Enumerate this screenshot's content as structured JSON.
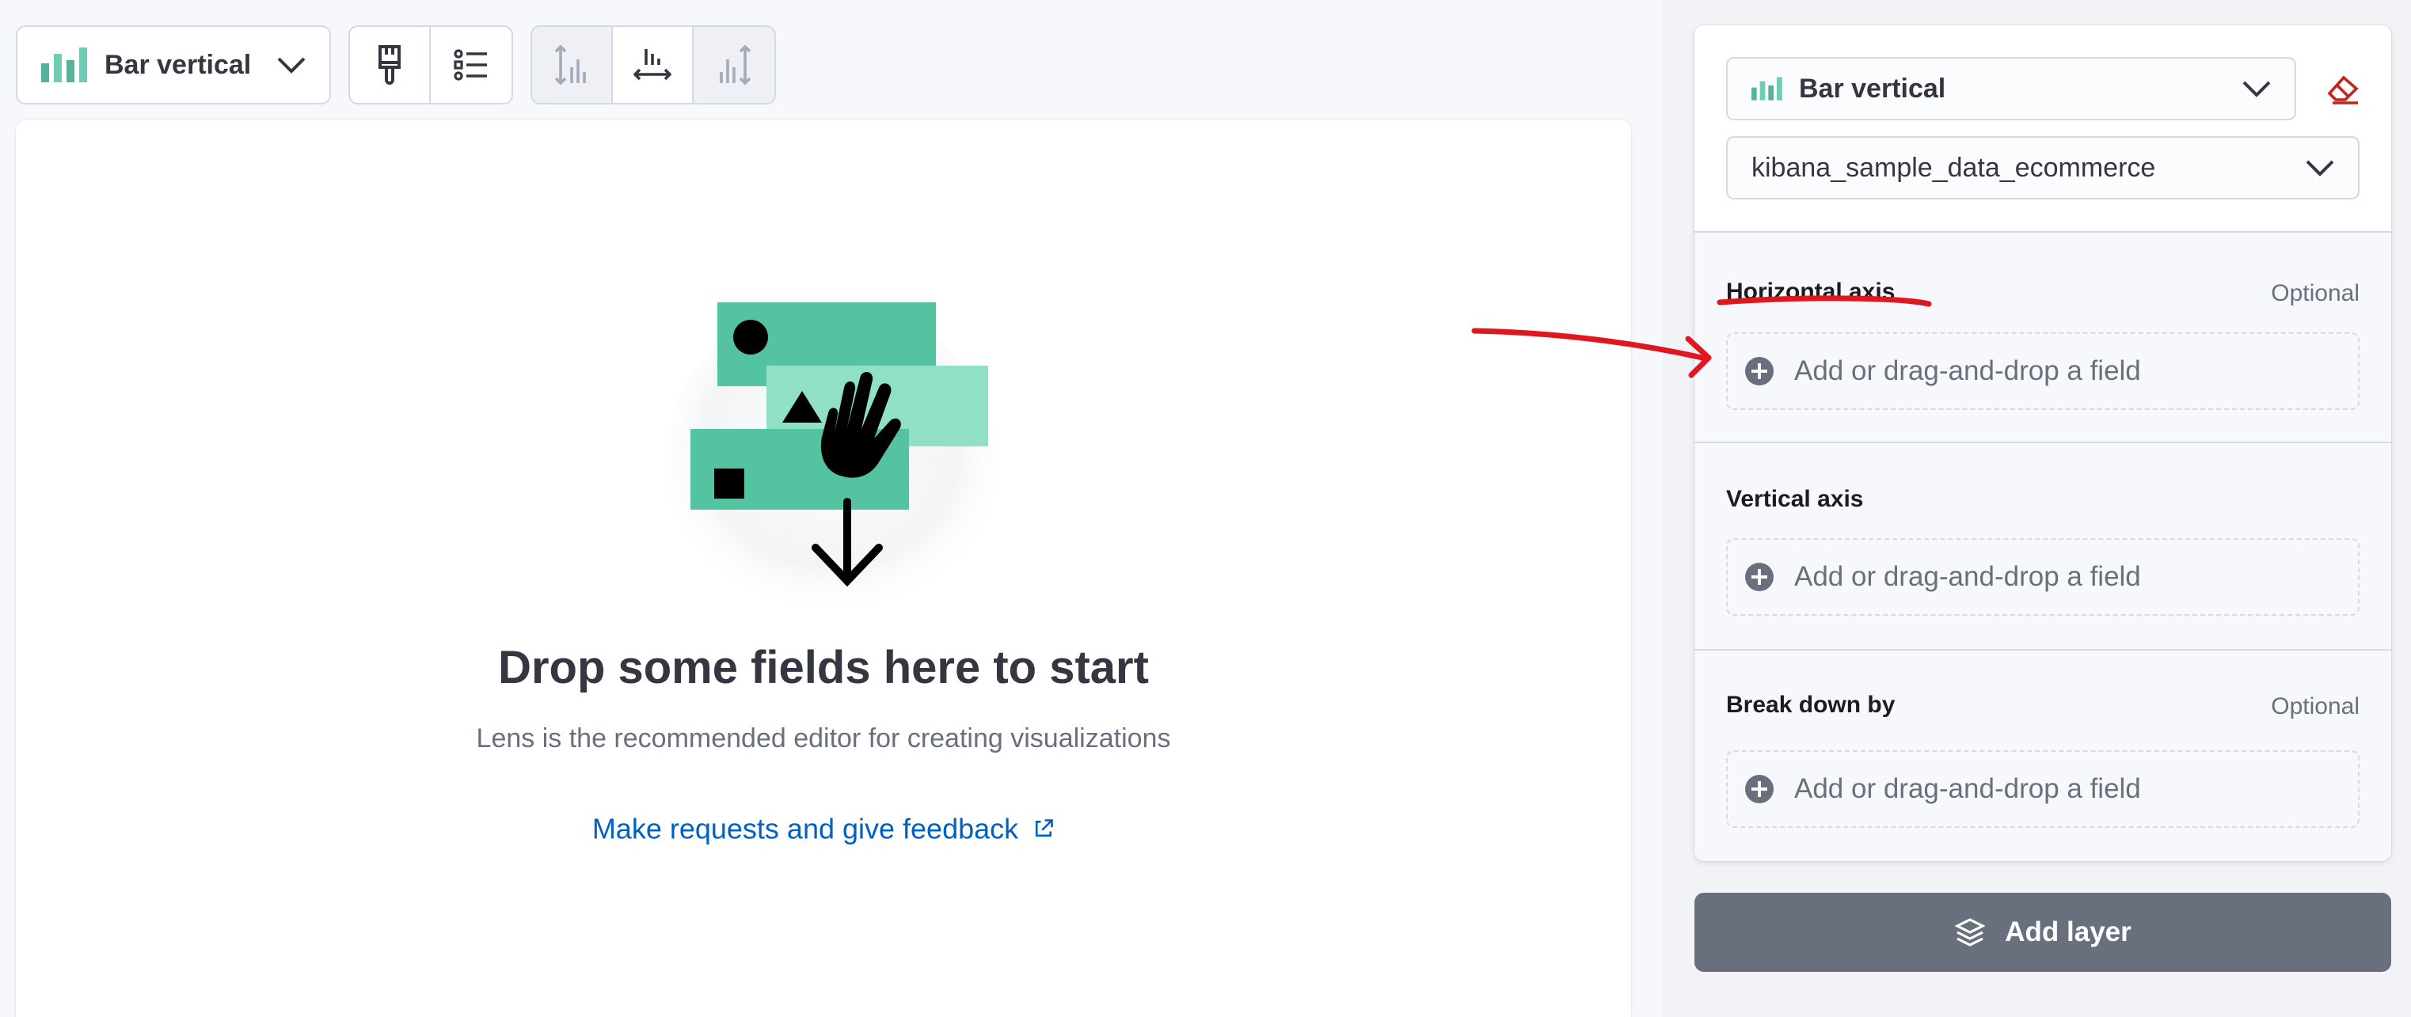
{
  "toolbar": {
    "chart_type_label": "Bar vertical",
    "icons": [
      "bar-chart-icon",
      "chevron-down-icon",
      "paintbrush-icon",
      "legend-list-icon",
      "left-axis-icon",
      "bottom-axis-icon",
      "right-axis-icon"
    ]
  },
  "workspace": {
    "title": "Drop some fields here to start",
    "subtitle": "Lens is the recommended editor for creating visualizations",
    "feedback_link": "Make requests and give feedback"
  },
  "panel": {
    "chart_type": "Bar vertical",
    "index_pattern": "kibana_sample_data_ecommerce",
    "sections": {
      "horizontal": {
        "title": "Horizontal axis",
        "optional": "Optional",
        "placeholder": "Add or drag-and-drop a field"
      },
      "vertical": {
        "title": "Vertical axis",
        "placeholder": "Add or drag-and-drop a field"
      },
      "breakdown": {
        "title": "Break down by",
        "optional": "Optional",
        "placeholder": "Add or drag-and-drop a field"
      }
    },
    "add_layer": "Add layer"
  },
  "colors": {
    "accent_green": "#54b399",
    "link_blue": "#0061c2",
    "annotation_red": "#e0171f",
    "danger_red": "#bd271e",
    "button_gray": "#69707d"
  }
}
